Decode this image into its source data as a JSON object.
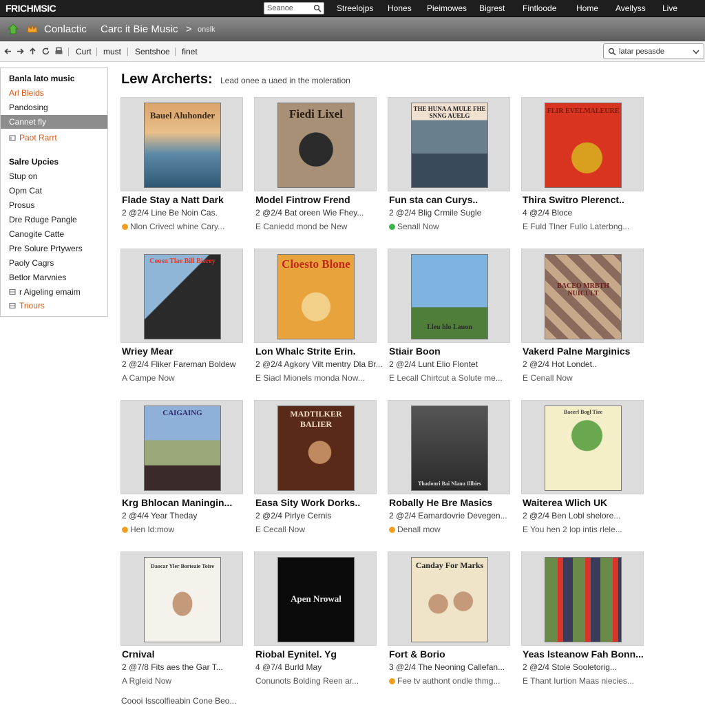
{
  "topbar": {
    "logo": "FRICHMSIC",
    "search_placeholder": "Seanoe",
    "nav": [
      "Streelojps",
      "Hones",
      "Pieimowes",
      "Bigrest",
      "Fintloode",
      "Home",
      "Avellyss",
      "Live"
    ]
  },
  "breadcrumb": {
    "item1": "Conlactic",
    "item2": "Carc it Bie Music",
    "arrow": ">",
    "item3": "onslk"
  },
  "toolbar": {
    "links": [
      "Curt",
      "must",
      "Sentshoe",
      "finet"
    ],
    "select_value": "latar pesasde"
  },
  "sidebar": {
    "items": [
      {
        "label": "Banla lato music",
        "style": "head"
      },
      {
        "label": "Arl Bleids",
        "style": "orange"
      },
      {
        "label": "Pandosing",
        "style": "normal"
      },
      {
        "label": "Cannet fly",
        "style": "selected"
      },
      {
        "label": "Paot Rarrt",
        "style": "orange-icon"
      },
      {
        "label": "Salre Upcies",
        "style": "head"
      },
      {
        "label": "Stup on",
        "style": "normal"
      },
      {
        "label": "Opm Cat",
        "style": "normal"
      },
      {
        "label": "Prosus",
        "style": "normal"
      },
      {
        "label": "Dre Rduge Pangle",
        "style": "normal"
      },
      {
        "label": "Canogite Catte",
        "style": "normal"
      },
      {
        "label": "Pre Solure Prtywers",
        "style": "normal"
      },
      {
        "label": "Paoly Cagrs",
        "style": "normal"
      },
      {
        "label": "Betlor Marvnies",
        "style": "normal"
      },
      {
        "label": "r Aigeling emaim",
        "style": "icon"
      },
      {
        "label": "Triours",
        "style": "orange-icon"
      }
    ]
  },
  "main": {
    "title": "Lew Archerts:",
    "subtitle": "Lead onee a uaed in the moleration",
    "footer": "Coooi Isscolfieabin Cone Beo..."
  },
  "cards": [
    {
      "title": "Flade Stay a Natt Dark",
      "meta": "2 @2/4 Line Be Noin Cas.",
      "status": "Nlon Crivecl whine Cary...",
      "dot": "#f0a020",
      "art_text": "Bauel Aluhonder",
      "art_theme": "sunset"
    },
    {
      "title": "Model Fintrow Frend",
      "meta": "2 @2/4 Bat oreen Wie Fhey...",
      "status": "E Caniedd mond be New",
      "dot": "",
      "art_text": "Fiedi Lixel",
      "art_theme": "portrait-sepia"
    },
    {
      "title": "Fun sta can Curys..",
      "meta": "2 @2/4 Blig Crmile Sugle",
      "status": "Senall Now",
      "dot": "#3bb54a",
      "art_text": "THE HUNA A MULE FHE SNNG AUELG",
      "art_theme": "people-red"
    },
    {
      "title": "Thira Switro Plerenct..",
      "meta": "4 @2/4 Bloce",
      "status": "E Fuld Tlner Fullo Laterbng...",
      "dot": "",
      "art_text": "FLIR EVELMALEURE",
      "art_theme": "red-animal"
    },
    {
      "title": "Wriey Mear",
      "meta": "2 @2/4 Fliker Fareman Boldew",
      "status": "A Campe Now",
      "dot": "",
      "art_text": "Coosn Tlae Bill Bierey",
      "art_theme": "silhouette"
    },
    {
      "title": "Lon Whalc Strite Erin.",
      "meta": "2 @2/4 Agkory Vilt mentry Dla Br...",
      "status": "E Siacl Mionels monda Now...",
      "dot": "",
      "art_text": "Cloesto Blone",
      "art_theme": "cartoon"
    },
    {
      "title": "Stiair Boon",
      "meta": "2 @2/4 Lunt Elio Flontet",
      "status": "E Lecall Chirtcut a Solute me...",
      "dot": "",
      "art_text": "Lleu hlo Lauon",
      "art_theme": "dancer"
    },
    {
      "title": "Vakerd Palne Marginics",
      "meta": "2 @2/4 Hot Londet..",
      "status": "E Cenall Now",
      "dot": "",
      "art_text": "BACEO MRBTH NUICULT",
      "art_theme": "collage"
    },
    {
      "title": "Krg Bhlocan Maningin...",
      "meta": "2 @4/4 Year Theday",
      "status": "Hen Id:mow",
      "dot": "#f0a020",
      "art_text": "CAIGAING",
      "art_theme": "landscape"
    },
    {
      "title": "Easa Sity Work Dorks..",
      "meta": "2 @2/4 Pirlye Cernis",
      "status": "E Cecall Now",
      "dot": "",
      "art_text": "MADTILKER BALIER",
      "art_theme": "dark-portrait"
    },
    {
      "title": "Robally He Bre Masics",
      "meta": "2 @2/4 Eamardovrie Devegen...",
      "status": "Denall mow",
      "dot": "#f0a020",
      "art_text": "Thadonri Bai Nlanu Illbies",
      "art_theme": "forest"
    },
    {
      "title": "Waiterea Wlich UK",
      "meta": "2 @2/4 Ben Lobl shelore...",
      "status": "E You hen 2 lop intis rlele...",
      "dot": "",
      "art_text": "Baeerl Bogl Tiee",
      "art_theme": "tree"
    },
    {
      "title": "Crnival",
      "meta": "2 @7/8 Fits aes the Gar T...",
      "status": "A Rgleid Now",
      "dot": "",
      "art_text": "Daocar Yler Borteaie Toire",
      "art_theme": "headshot"
    },
    {
      "title": "Riobal Eynitel. Yg",
      "meta": "4 @7/4 Burld May",
      "status": "Conunots Bolding Reen ar...",
      "dot": "",
      "art_text": "Apen Nrowal",
      "art_theme": "black"
    },
    {
      "title": "Fort & Borio",
      "meta": "3 @2/4 The Neoning Callefan...",
      "status": "Fee tv authont ondle thmg...",
      "dot": "#f0a020",
      "art_text": "Canday For Marks",
      "art_theme": "duo"
    },
    {
      "title": "Yeas lsteanow Fah Bonn...",
      "meta": "2 @2/4 Stole Sooletorig...",
      "status": "E Thant Iurtion Maas niecies...",
      "dot": "",
      "art_text": "",
      "art_theme": "crowd"
    }
  ],
  "colors": {
    "accent_orange": "#d65a1c",
    "status_orange": "#f0a020",
    "status_green": "#3bb54a",
    "selected_gray": "#8d8d8d"
  }
}
